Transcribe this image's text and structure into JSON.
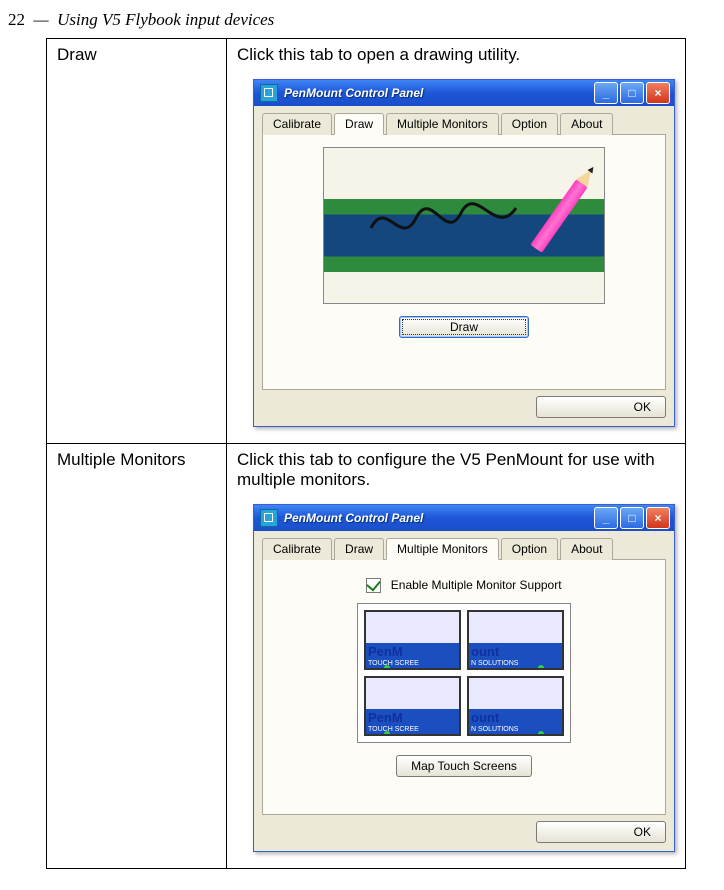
{
  "page": {
    "number": "22",
    "section": "Using V5 Flybook input devices"
  },
  "rows": {
    "draw": {
      "label": "Draw",
      "desc": "Click this tab to open a drawing utility.",
      "window": {
        "title": "PenMount Control Panel",
        "tabs": {
          "calibrate": "Calibrate",
          "draw": "Draw",
          "multiple": "Multiple Monitors",
          "option": "Option",
          "about": "About"
        },
        "draw_button": "Draw",
        "ok": "OK"
      }
    },
    "multi": {
      "label": "Multiple Monitors",
      "desc": "Click this tab to configure the V5 PenMount for use with multiple monitors.",
      "window": {
        "title": "PenMount Control Panel",
        "tabs": {
          "calibrate": "Calibrate",
          "draw": "Draw",
          "multiple": "Multiple Monitors",
          "option": "Option",
          "about": "About"
        },
        "enable_label": "Enable Multiple Monitor Support",
        "map_button": "Map Touch Screens",
        "ok": "OK",
        "monitors": {
          "tl_logo": "PenM",
          "tl_sub": "TOUCH SCREE",
          "tr_logo": "ount",
          "tr_sub": "N SOLUTIONS",
          "bl_logo": "PenM",
          "bl_sub": "TOUCH SCREE",
          "br_logo": "ount",
          "br_sub": "N SOLUTIONS"
        }
      }
    }
  }
}
